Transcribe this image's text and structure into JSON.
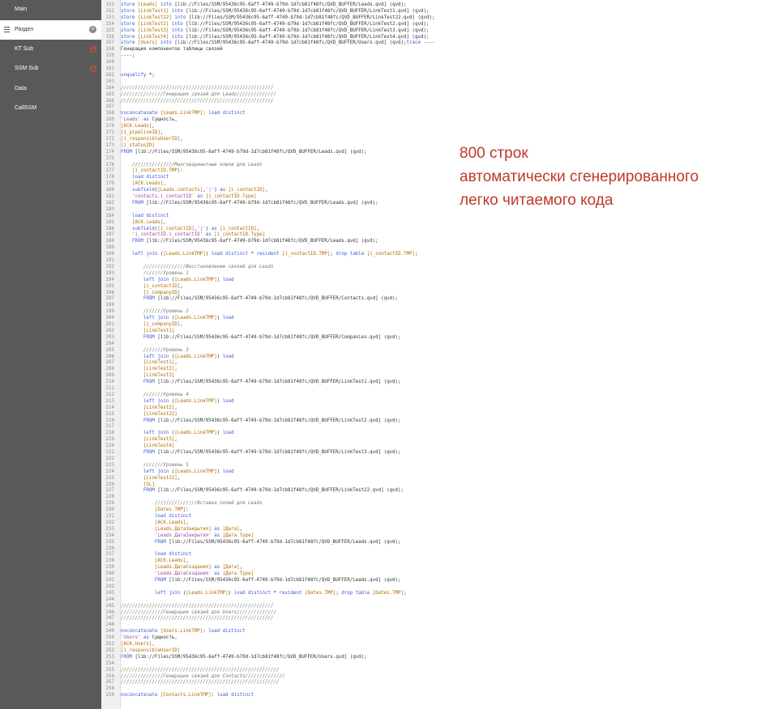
{
  "sidebar": {
    "items": [
      {
        "label": "Main"
      },
      {
        "label": "Раздел",
        "active": true
      },
      {
        "label": "KT Sub"
      },
      {
        "label": "SSM Sub"
      },
      {
        "label": "Data"
      },
      {
        "label": "CallSSM"
      }
    ],
    "close_glyph": "×"
  },
  "annotation": {
    "lines": [
      "800 строк",
      "автоматически сгенерированного",
      "легко читаемого кода"
    ]
  },
  "code": {
    "lines": [
      {
        "n": "151",
        "t": "store [Leads] into [lib://Files/SSM/95436c95-6aff-4749-b79d-1d7cb81f48fc/QVD_BUFFER/Leads.qvd] (qvd);"
      },
      {
        "n": "152",
        "t": "store [LinkTest1] into [lib://Files/SSM/95436c95-6aff-4749-b79d-1d7cb81f48fc/QVD_BUFFER/LinkTest1.qvd] (qvd);"
      },
      {
        "n": "153",
        "t": "store [LinkTest22] into [lib://Files/SSM/95436c95-6aff-4749-b79d-1d7cb81f48fc/QVD_BUFFER/LinkTest22.qvd] (qvd);"
      },
      {
        "n": "154",
        "t": "store [LinkTest2] into [lib://Files/SSM/95436c95-6aff-4749-b79d-1d7cb81f48fc/QVD_BUFFER/LinkTest2.qvd] (qvd);"
      },
      {
        "n": "155",
        "t": "store [LinkTest3] into [lib://Files/SSM/95436c95-6aff-4749-b79d-1d7cb81f48fc/QVD_BUFFER/LinkTest3.qvd] (qvd);"
      },
      {
        "n": "156",
        "t": "store [LinkTest4] into [lib://Files/SSM/95436c95-6aff-4749-b79d-1d7cb81f48fc/QVD_BUFFER/LinkTest4.qvd] (qvd);"
      },
      {
        "n": "157",
        "t": "store [Users] into [lib://Files/SSM/95436c95-6aff-4749-b79d-1d7cb81f48fc/QVD_BUFFER/Users.qvd] (qvd);trace ----"
      },
      {
        "n": "158",
        "t": "Генерация компонентов таблицы связей"
      },
      {
        "n": "159",
        "t": "----;"
      },
      {
        "n": "160",
        "t": ""
      },
      {
        "n": "161",
        "t": ""
      },
      {
        "n": "162",
        "t": "unqualify *;"
      },
      {
        "n": "163",
        "t": ""
      },
      {
        "n": "164",
        "t": "//////////////////////////////////////////////////////"
      },
      {
        "n": "165",
        "t": "///////////////Генерация связей для Leads//////////////"
      },
      {
        "n": "166",
        "t": "//////////////////////////////////////////////////////"
      },
      {
        "n": "167",
        "t": ""
      },
      {
        "n": "168",
        "t": "noconcatenate [Leads.LinkTMP]: load distinct"
      },
      {
        "n": "169",
        "t": "'Leads' as Сущность,"
      },
      {
        "n": "170",
        "t": "[ACK.Leads],"
      },
      {
        "n": "171",
        "t": "[i_pipelineID],"
      },
      {
        "n": "172",
        "t": "[i_responsibleUserID],"
      },
      {
        "n": "173",
        "t": "[i_statusID]"
      },
      {
        "n": "174",
        "t": "FROM [lib://Files/SSM/95436c95-6aff-4749-b79d-1d7cb81f48fc/QVD_BUFFER/Leads.qvd] (qvd);"
      },
      {
        "n": "175",
        "t": ""
      },
      {
        "n": "176",
        "t": "    ///////////////Многовариантные ключи для Leads"
      },
      {
        "n": "177",
        "t": "    [i_contactID.TMP]:"
      },
      {
        "n": "178",
        "t": "    load distinct"
      },
      {
        "n": "179",
        "t": "    [ACK.Leads],"
      },
      {
        "n": "180",
        "t": "    subfield([Leads.contacts],'|') as [i_contactID],"
      },
      {
        "n": "181",
        "t": "    'contacts.i_contactID' as [i_contactID.Type]"
      },
      {
        "n": "182",
        "t": "    FROM [lib://Files/SSM/95436c95-6aff-4749-b79d-1d7cb81f48fc/QVD_BUFFER/Leads.qvd] (qvd);"
      },
      {
        "n": "183",
        "t": ""
      },
      {
        "n": "184",
        "t": "    load distinct"
      },
      {
        "n": "185",
        "t": "    [ACK.Leads],"
      },
      {
        "n": "186",
        "t": "    subfield([i_contactID],'|') as [i_contactID],"
      },
      {
        "n": "187",
        "t": "    'i_contactID.i_contactID' as [i_contactID.Type]"
      },
      {
        "n": "188",
        "t": "    FROM [lib://Files/SSM/95436c95-6aff-4749-b79d-1d7cb81f48fc/QVD_BUFFER/Leads.qvd] (qvd);"
      },
      {
        "n": "189",
        "t": ""
      },
      {
        "n": "190",
        "t": "    left join ([Leads.LinkTMP]) load distinct * resident [i_contactID.TMP]; drop table [i_contactID.TMP];"
      },
      {
        "n": "191",
        "t": ""
      },
      {
        "n": "192",
        "t": "        ///////////////Восстановление связей для Leads"
      },
      {
        "n": "193",
        "t": "        ///////Уровень 1"
      },
      {
        "n": "194",
        "t": "        left join ([Leads.LinkTMP]) load"
      },
      {
        "n": "195",
        "t": "        [i_contactID],"
      },
      {
        "n": "196",
        "t": "        [i_companyID]"
      },
      {
        "n": "197",
        "t": "        FROM [lib://Files/SSM/95436c95-6aff-4749-b79d-1d7cb81f48fc/QVD_BUFFER/Contacts.qvd] (qvd);"
      },
      {
        "n": "198",
        "t": ""
      },
      {
        "n": "199",
        "t": "        ///////Уровень 2"
      },
      {
        "n": "200",
        "t": "        left join ([Leads.LinkTMP]) load"
      },
      {
        "n": "201",
        "t": "        [i_companyID],"
      },
      {
        "n": "202",
        "t": "        [LinkTest1]"
      },
      {
        "n": "203",
        "t": "        FROM [lib://Files/SSM/95436c95-6aff-4749-b79d-1d7cb81f48fc/QVD_BUFFER/Companies.qvd] (qvd);"
      },
      {
        "n": "204",
        "t": ""
      },
      {
        "n": "205",
        "t": "        ///////Уровень 3"
      },
      {
        "n": "206",
        "t": "        left join ([Leads.LinkTMP]) load"
      },
      {
        "n": "207",
        "t": "        [LinkTest1],"
      },
      {
        "n": "208",
        "t": "        [LinkTest2],"
      },
      {
        "n": "209",
        "t": "        [LinkTest3]"
      },
      {
        "n": "210",
        "t": "        FROM [lib://Files/SSM/95436c95-6aff-4749-b79d-1d7cb81f48fc/QVD_BUFFER/LinkTest1.qvd] (qvd);"
      },
      {
        "n": "211",
        "t": ""
      },
      {
        "n": "212",
        "t": "        ///////Уровень 4"
      },
      {
        "n": "213",
        "t": "        left join ([Leads.LinkTMP]) load"
      },
      {
        "n": "214",
        "t": "        [LinkTest2],"
      },
      {
        "n": "215",
        "t": "        [LinkTest22]"
      },
      {
        "n": "216",
        "t": "        FROM [lib://Files/SSM/95436c95-6aff-4749-b79d-1d7cb81f48fc/QVD_BUFFER/LinkTest2.qvd] (qvd);"
      },
      {
        "n": "217",
        "t": ""
      },
      {
        "n": "218",
        "t": "        left join ([Leads.LinkTMP]) load"
      },
      {
        "n": "219",
        "t": "        [LinkTest3],"
      },
      {
        "n": "220",
        "t": "        [LinkTest4]"
      },
      {
        "n": "221",
        "t": "        FROM [lib://Files/SSM/95436c95-6aff-4749-b79d-1d7cb81f48fc/QVD_BUFFER/LinkTest3.qvd] (qvd);"
      },
      {
        "n": "222",
        "t": ""
      },
      {
        "n": "223",
        "t": "        ///////Уровень 5"
      },
      {
        "n": "224",
        "t": "        left join ([Leads.LinkTMP]) load"
      },
      {
        "n": "225",
        "t": "        [LinkTest22],"
      },
      {
        "n": "226",
        "t": "        [SL]"
      },
      {
        "n": "227",
        "t": "        FROM [lib://Files/SSM/95436c95-6aff-4749-b79d-1d7cb81f48fc/QVD_BUFFER/LinkTest22.qvd] (qvd);"
      },
      {
        "n": "228",
        "t": ""
      },
      {
        "n": "229",
        "t": "            ///////////////Вставка полей для Leads"
      },
      {
        "n": "230",
        "t": "            [Dates.TMP]:"
      },
      {
        "n": "231",
        "t": "            load distinct"
      },
      {
        "n": "232",
        "t": "            [ACK.Leads],"
      },
      {
        "n": "233",
        "t": "            [Leads.ДатаЗакрытия] as [Дата],"
      },
      {
        "n": "234",
        "t": "            'Leads.ДатаЗакрытия' as [Дата.Type]"
      },
      {
        "n": "235",
        "t": "            FROM [lib://Files/SSM/95436c95-6aff-4749-b79d-1d7cb81f48fc/QVD_BUFFER/Leads.qvd] (qvd);"
      },
      {
        "n": "236",
        "t": ""
      },
      {
        "n": "237",
        "t": "            load distinct"
      },
      {
        "n": "238",
        "t": "            [ACK.Leads],"
      },
      {
        "n": "239",
        "t": "            [Leads.ДатаСоздания] as [Дата],"
      },
      {
        "n": "240",
        "t": "            'Leads.ДатаСоздания' as [Дата.Type]"
      },
      {
        "n": "241",
        "t": "            FROM [lib://Files/SSM/95436c95-6aff-4749-b79d-1d7cb81f48fc/QVD_BUFFER/Leads.qvd] (qvd);"
      },
      {
        "n": "242",
        "t": ""
      },
      {
        "n": "243",
        "t": "            left join ([Leads.LinkTMP]) load distinct * resident [Dates.TMP]; drop table [Dates.TMP];"
      },
      {
        "n": "244",
        "t": ""
      },
      {
        "n": "245",
        "t": "//////////////////////////////////////////////////////"
      },
      {
        "n": "246",
        "t": "///////////////Генерация связей для Users//////////////"
      },
      {
        "n": "247",
        "t": "//////////////////////////////////////////////////////"
      },
      {
        "n": "248",
        "t": ""
      },
      {
        "n": "249",
        "t": "noconcatenate [Users.LinkTMP]: load distinct"
      },
      {
        "n": "250",
        "t": "'Users' as Сущность,"
      },
      {
        "n": "251",
        "t": "[ACK.Users],"
      },
      {
        "n": "252",
        "t": "[i_responsibleUserID]"
      },
      {
        "n": "253",
        "t": "FROM [lib://Files/SSM/95436c95-6aff-4749-b79d-1d7cb81f48fc/QVD_BUFFER/Users.qvd] (qvd);"
      },
      {
        "n": "254",
        "t": ""
      },
      {
        "n": "255",
        "t": "////////////////////////////////////////////////////////"
      },
      {
        "n": "256",
        "t": "///////////////Генерация связей для Contacts//////////////"
      },
      {
        "n": "257",
        "t": "////////////////////////////////////////////////////////"
      },
      {
        "n": "258",
        "t": ""
      },
      {
        "n": "259",
        "t": "noconcatenate [Contacts.LinkTMP]: load distinct"
      }
    ]
  }
}
